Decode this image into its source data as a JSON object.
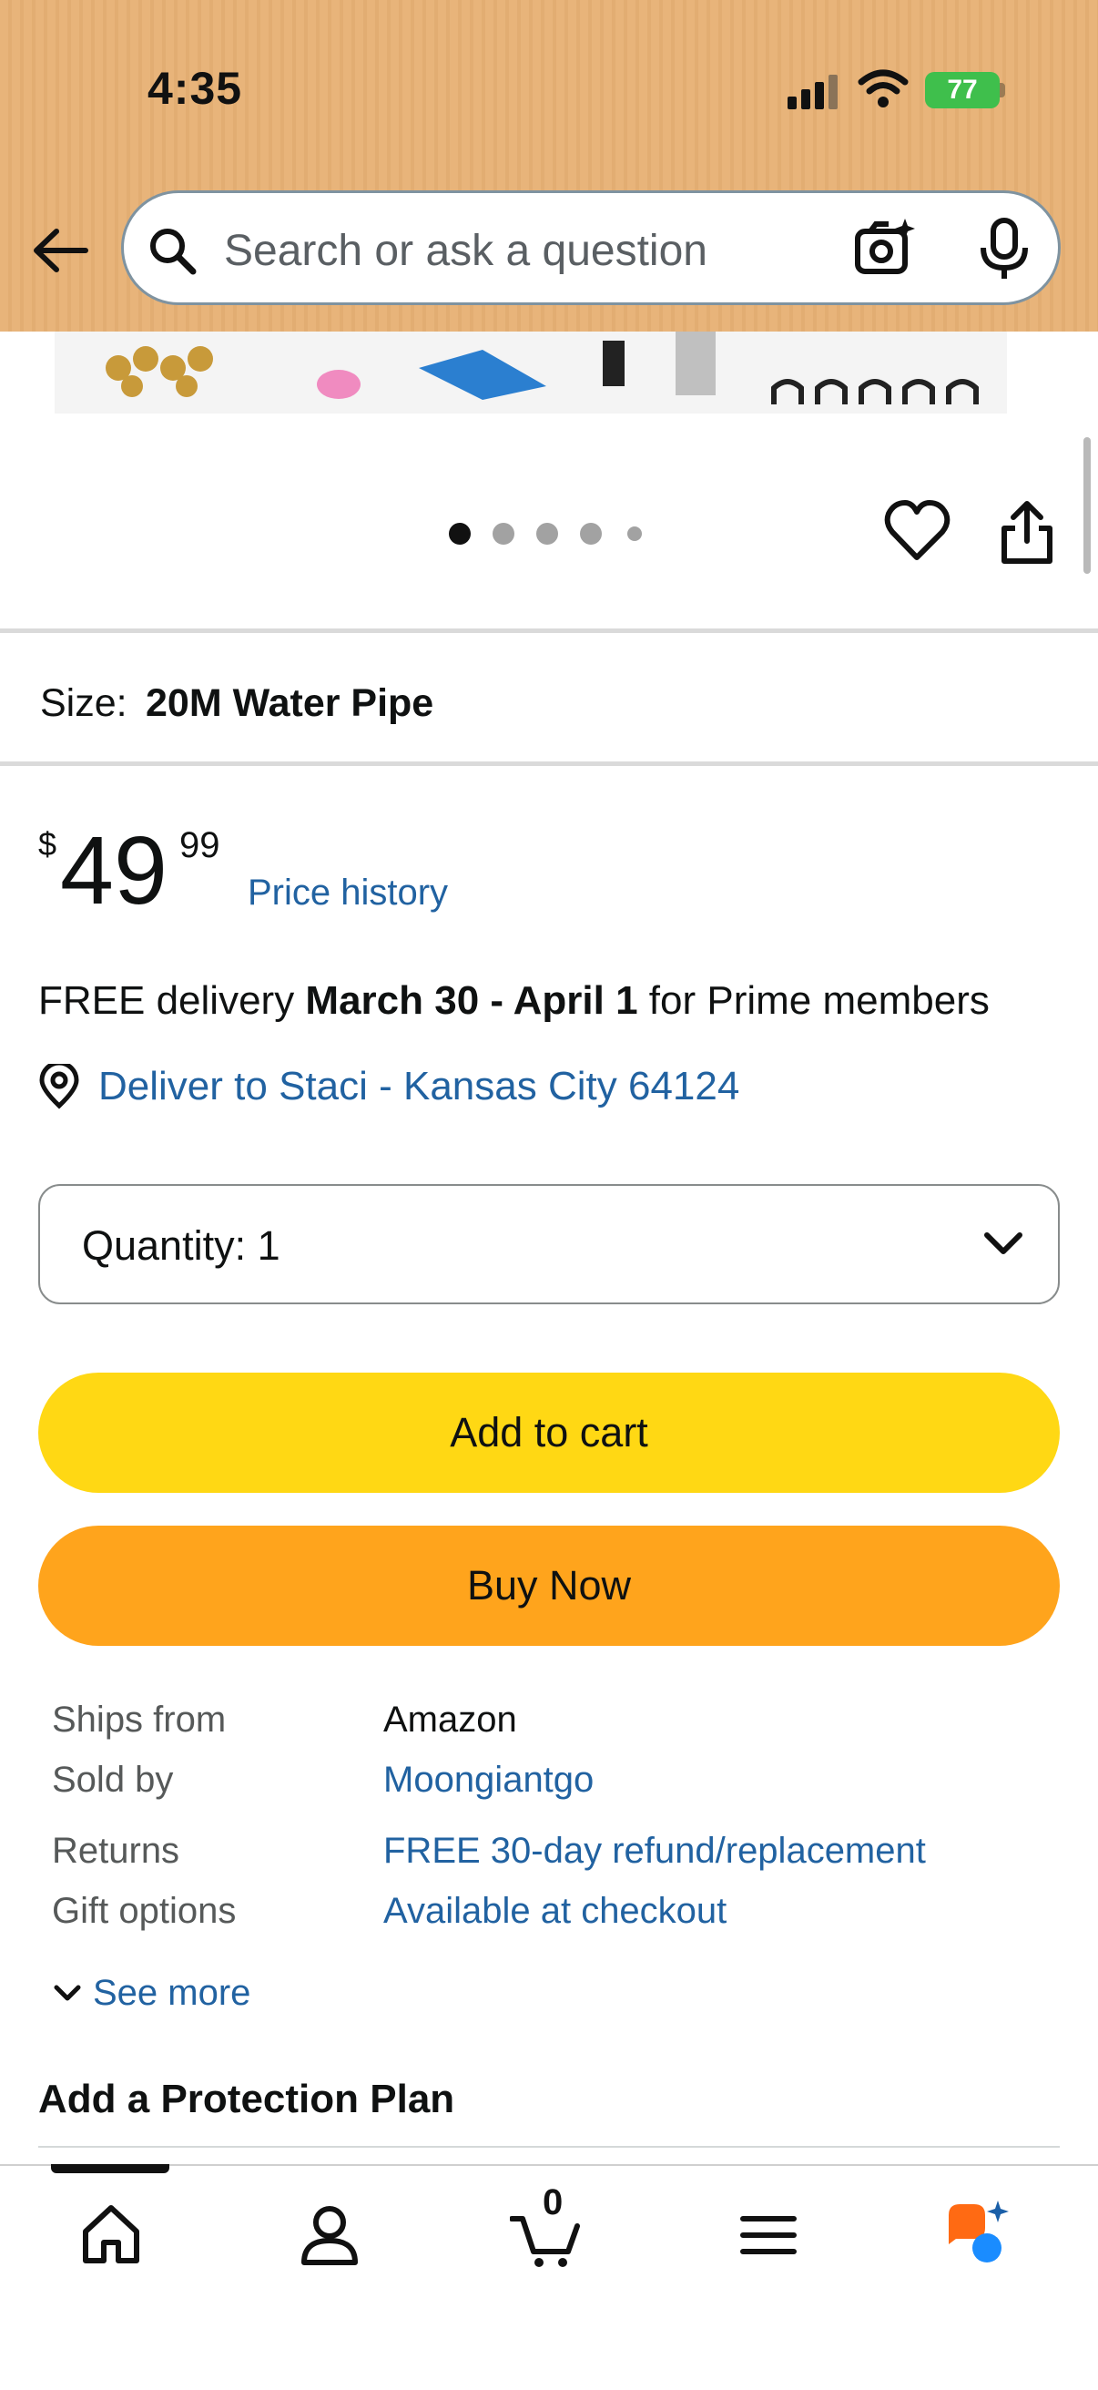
{
  "status_bar": {
    "time": "4:35",
    "battery": "77"
  },
  "search": {
    "placeholder": "Search or ask a question"
  },
  "product": {
    "size_label": "Size:",
    "size_value": "20M Water Pipe",
    "price_symbol": "$",
    "price_whole": "49",
    "price_fraction": "99",
    "price_history_link": "Price history",
    "delivery_prefix": "FREE delivery ",
    "delivery_dates": "March 30 - April 1",
    "delivery_suffix": " for Prime members",
    "deliver_to": "Deliver to Staci - Kansas City 64124",
    "quantity_label": "Quantity: 1",
    "add_to_cart": "Add to cart",
    "buy_now": "Buy Now",
    "carousel": {
      "pages": 5,
      "active_index": 0
    }
  },
  "details": [
    {
      "label": "Ships from",
      "value": "Amazon",
      "is_link": false
    },
    {
      "label": "Sold by",
      "value": "Moongiantgo",
      "is_link": true
    },
    {
      "label": "Returns",
      "value": "FREE 30-day refund/replacement",
      "is_link": true
    },
    {
      "label": "Gift options",
      "value": "Available at checkout",
      "is_link": true
    }
  ],
  "see_more": "See more",
  "protection_title": "Add a Protection Plan",
  "bottom_nav": {
    "items": [
      "home-icon",
      "account-icon",
      "cart-icon",
      "menu-icon",
      "rufus-icon"
    ],
    "cart_count": "0"
  },
  "colors": {
    "header_bg": "#e8b47a",
    "add_to_cart_bg": "#ffd814",
    "buy_now_bg": "#ffa41c",
    "link": "#2162a1"
  }
}
